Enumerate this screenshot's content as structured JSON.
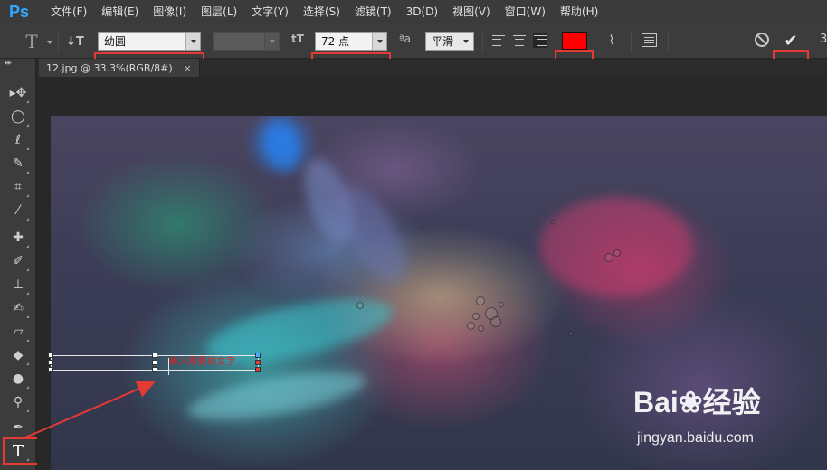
{
  "app": {
    "logo": "Ps"
  },
  "menu": [
    "文件(F)",
    "编辑(E)",
    "图像(I)",
    "图层(L)",
    "文字(Y)",
    "选择(S)",
    "滤镜(T)",
    "3D(D)",
    "视图(V)",
    "窗口(W)",
    "帮助(H)"
  ],
  "options": {
    "font_family": "幼圆",
    "font_style": "-",
    "font_size": "72 点",
    "anti_alias": "平滑",
    "text_color": "#ff0000",
    "size_icon_label": "tT",
    "aa_icon_label": "ªa",
    "three_d_label": "3"
  },
  "document": {
    "tab_title": "12.jpg @ 33.3%(RGB/8#)",
    "close_symbol": "×",
    "text_layer_content": "输入需要的文字"
  },
  "tools": [
    "move-tool",
    "marquee-tool",
    "lasso-tool",
    "quick-select-tool",
    "crop-tool",
    "eyedropper-tool",
    "healing-tool",
    "brush-tool",
    "stamp-tool",
    "history-brush-tool",
    "eraser-tool",
    "paint-bucket-tool",
    "blur-tool",
    "dodge-tool",
    "pen-tool",
    "type-tool"
  ],
  "watermark": {
    "logo_text": "Bai❀经验",
    "url": "jingyan.baidu.com"
  },
  "colors": {
    "highlight": "#e53935",
    "menubar_bg": "#3b3b3b",
    "panel_bg": "#3c3c3c",
    "ps_blue": "#31a8ff"
  }
}
